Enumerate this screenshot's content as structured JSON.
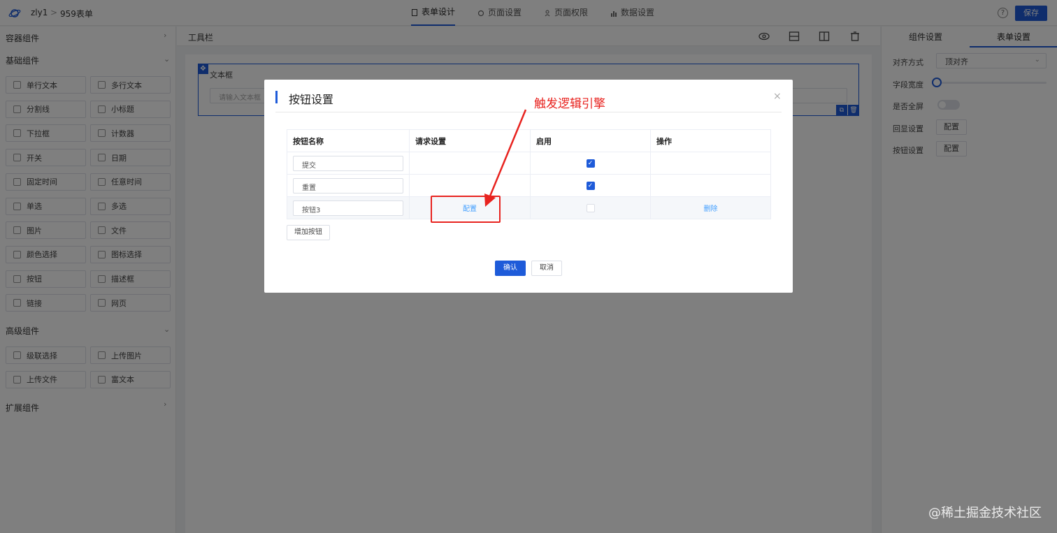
{
  "header": {
    "app_name": "zly1",
    "separator": ">",
    "page_name": "959表单",
    "tabs": [
      {
        "label": "表单设计",
        "active": true
      },
      {
        "label": "页面设置",
        "active": false
      },
      {
        "label": "页面权限",
        "active": false
      },
      {
        "label": "数据设置",
        "active": false
      }
    ],
    "help_glyph": "?",
    "save_label": "保存"
  },
  "sidebar": {
    "container_group": "容器组件",
    "basic_group": "基础组件",
    "basic_items": [
      "单行文本",
      "多行文本",
      "分割线",
      "小标题",
      "下拉框",
      "计数器",
      "开关",
      "日期",
      "固定时间",
      "任意时间",
      "单选",
      "多选",
      "图片",
      "文件",
      "颜色选择",
      "图标选择",
      "按钮",
      "描述框",
      "链接",
      "网页"
    ],
    "advanced_group": "高级组件",
    "advanced_items": [
      "级联选择",
      "上传图片",
      "上传文件",
      "富文本"
    ],
    "extension_group": "扩展组件"
  },
  "toolbar": {
    "label": "工具栏"
  },
  "canvas": {
    "field_label": "文本框",
    "field_placeholder": "请输入文本框"
  },
  "right_panel": {
    "tabs": [
      {
        "label": "组件设置",
        "active": false
      },
      {
        "label": "表单设置",
        "active": true
      }
    ],
    "align_label": "对齐方式",
    "align_value": "顶对齐",
    "field_width_label": "字段宽度",
    "field_width_value": 0,
    "fullscreen_label": "是否全屏",
    "fullscreen_on": false,
    "echo_label": "回显设置",
    "echo_button": "配置",
    "button_setting_label": "按钮设置",
    "button_setting_button": "配置"
  },
  "dialog": {
    "title": "按钮设置",
    "close_glyph": "×",
    "columns": [
      "按钮名称",
      "请求设置",
      "启用",
      "操作"
    ],
    "rows": [
      {
        "name": "提交",
        "request": "",
        "enabled": true,
        "action": ""
      },
      {
        "name": "重置",
        "request": "",
        "enabled": true,
        "action": ""
      },
      {
        "name": "按钮3",
        "request": "配置",
        "enabled": false,
        "action": "删除"
      }
    ],
    "add_button": "增加按钮",
    "confirm": "确认",
    "cancel": "取消"
  },
  "annotation": {
    "text": "触发逻辑引擎",
    "color": "#e8231f"
  },
  "watermark": "@稀土掘金技术社区",
  "colors": {
    "primary": "#1e5bd9",
    "link": "#409eff"
  }
}
